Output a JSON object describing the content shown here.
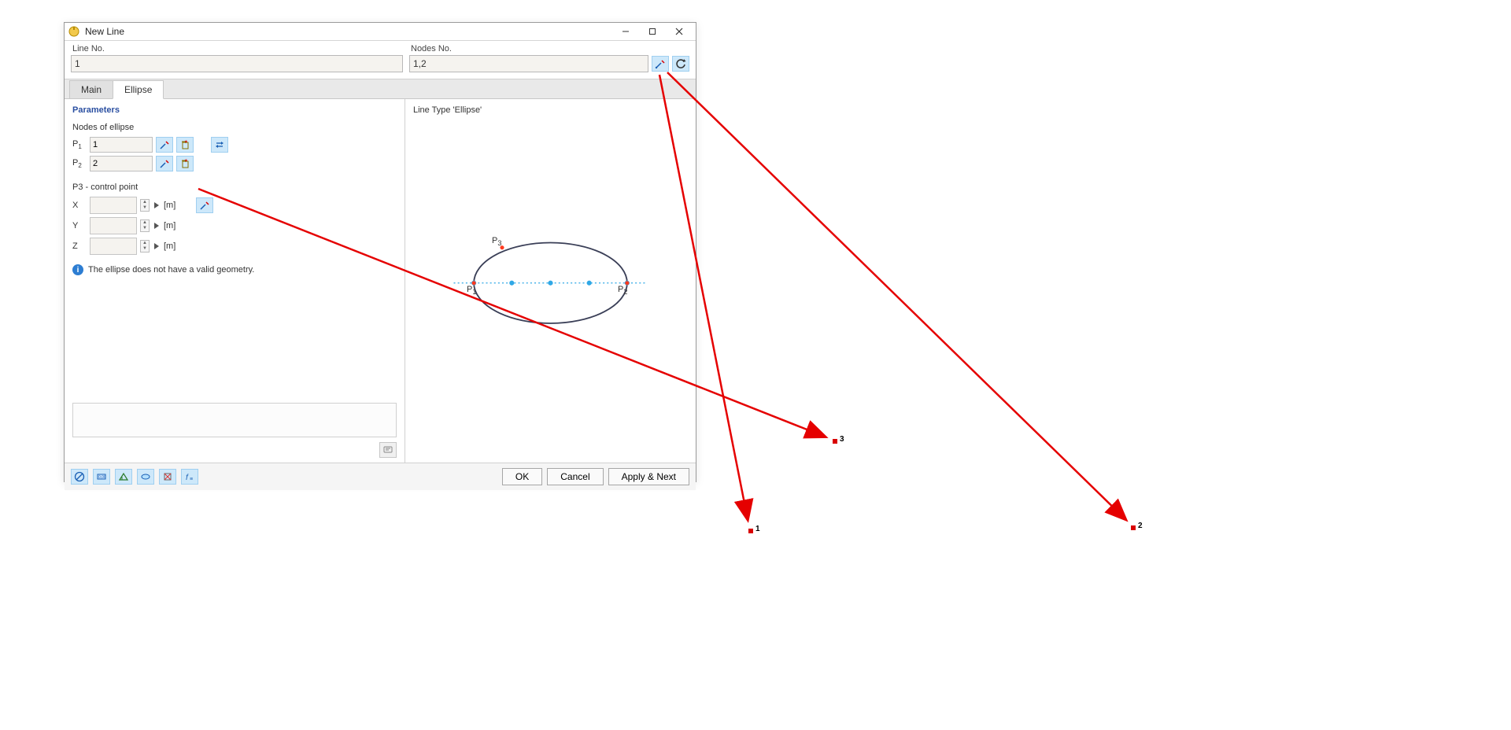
{
  "window": {
    "title": "New Line"
  },
  "header": {
    "line_no_label": "Line No.",
    "line_no_value": "1",
    "nodes_no_label": "Nodes No.",
    "nodes_no_value": "1,2"
  },
  "tabs": {
    "main": "Main",
    "ellipse": "Ellipse",
    "active": "ellipse"
  },
  "left": {
    "section_title": "Parameters",
    "nodes_title": "Nodes of ellipse",
    "p1_label_base": "P",
    "p1_label_sub": "1",
    "p1_value": "1",
    "p2_label_base": "P",
    "p2_label_sub": "2",
    "p2_value": "2",
    "p3_title": "P3 - control point",
    "x_label": "X",
    "y_label": "Y",
    "z_label": "Z",
    "x_value": "",
    "y_value": "",
    "z_value": "",
    "unit_x": "[m]",
    "unit_y": "[m]",
    "unit_z": "[m]",
    "info_message": "The ellipse does not have a valid geometry."
  },
  "right": {
    "preview_title": "Line Type 'Ellipse'",
    "p1_tag": "P",
    "p1_sub": "1",
    "p2_tag": "P",
    "p2_sub": "2",
    "p3_tag": "P",
    "p3_sub": "3"
  },
  "buttons": {
    "ok": "OK",
    "cancel": "Cancel",
    "apply_next": "Apply & Next"
  },
  "ext_points": {
    "pt1_label": "1",
    "pt2_label": "2",
    "pt3_label": "3"
  }
}
